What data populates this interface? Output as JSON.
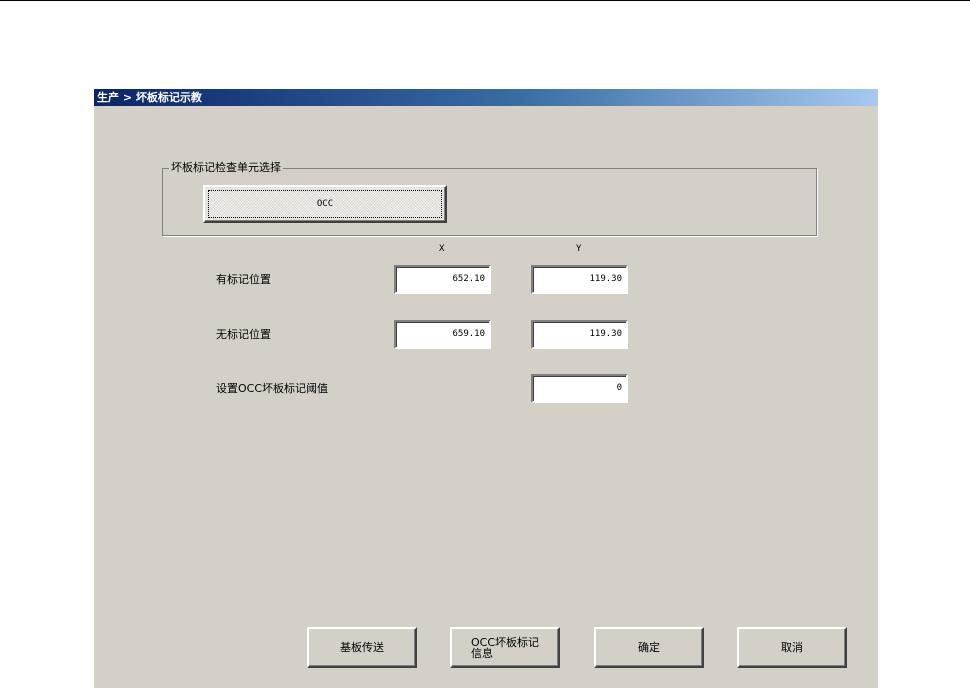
{
  "window": {
    "title": "生产 > 坏板标记示教"
  },
  "group": {
    "legend": "坏板标记检查单元选择",
    "unit_button_label": "OCC"
  },
  "columns": {
    "x": "X",
    "y": "Y"
  },
  "rows": {
    "marked": {
      "label": "有标记位置",
      "x": "652.10",
      "y": "119.30"
    },
    "unmarked": {
      "label": "无标记位置",
      "x": "659.10",
      "y": "119.30"
    },
    "threshold": {
      "label": "设置OCC坏板标记阈值",
      "value": "0"
    }
  },
  "buttons": {
    "transfer": "基板传送",
    "occ_info_line1": "OCC坏板标记",
    "occ_info_line2": "信息",
    "ok": "确定",
    "cancel": "取消"
  },
  "colors": {
    "face": "#d4d0c8",
    "title_start": "#0a246a",
    "title_end": "#a6caf0"
  }
}
